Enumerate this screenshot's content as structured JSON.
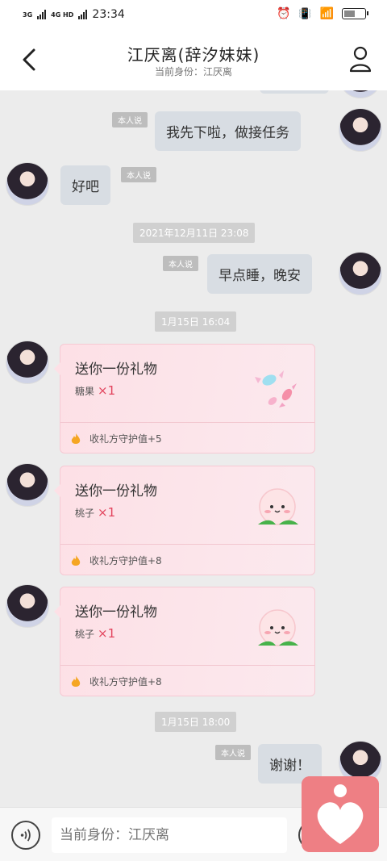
{
  "status_bar": {
    "network_1": "3G",
    "network_2": "4G HD",
    "time": "23:34",
    "battery_percent": 0.55
  },
  "header": {
    "title": "江厌离(辞汐妹妹)",
    "subtitle": "当前身份：江厌离"
  },
  "chat": {
    "messages": [
      {
        "side": "right",
        "tag": "本人说",
        "text": "我先下啦，做接任务"
      },
      {
        "side": "left",
        "tag": "本人说",
        "text": "好吧"
      },
      {
        "type": "time",
        "text": "2021年12月11日 23:08"
      },
      {
        "side": "right",
        "tag": "本人说",
        "text": "早点睡，晚安"
      },
      {
        "type": "time",
        "text": "1月15日 16:04"
      },
      {
        "side": "right",
        "tag": "本人说",
        "text": "谢谢！"
      }
    ],
    "gifts": [
      {
        "title": "送你一份礼物",
        "item": "糖果",
        "qty": "×1",
        "footer": "收礼方守护值+5",
        "icon": "candy-icon"
      },
      {
        "title": "送你一份礼物",
        "item": "桃子",
        "qty": "×1",
        "footer": "收礼方守护值+8",
        "icon": "peach-icon"
      },
      {
        "title": "送你一份礼物",
        "item": "桃子",
        "qty": "×1",
        "footer": "收礼方守护值+8",
        "icon": "peach-icon"
      }
    ],
    "time_3": "1月15日 18:00"
  },
  "input_bar": {
    "placeholder": "当前身份：江厌离"
  },
  "colors": {
    "bubble": "#d8dde3",
    "gift_bg": "#fde0e6",
    "accent": "#e2445d",
    "badge": "#ee7f84"
  }
}
